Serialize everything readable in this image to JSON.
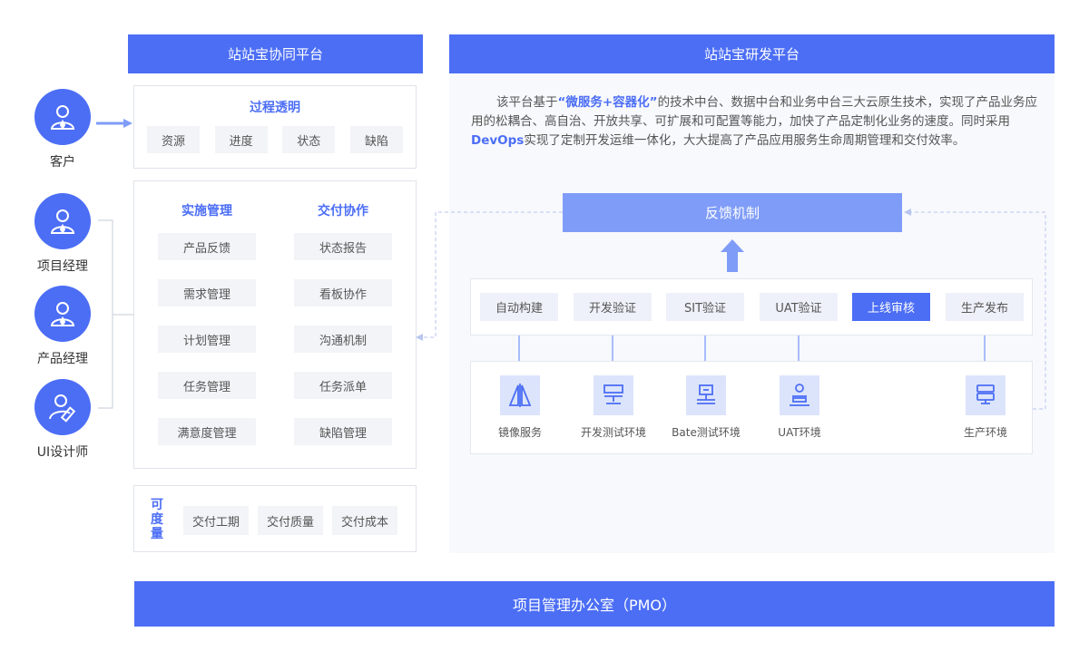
{
  "collab": {
    "title": "站站宝协同平台",
    "process": {
      "title": "过程透明",
      "items": [
        "资源",
        "进度",
        "状态",
        "缺陷"
      ]
    },
    "impl": {
      "title": "实施管理",
      "items": [
        "产品反馈",
        "需求管理",
        "计划管理",
        "任务管理",
        "满意度管理"
      ]
    },
    "deliv": {
      "title": "交付协作",
      "items": [
        "状态报告",
        "看板协作",
        "沟通机制",
        "任务派单",
        "缺陷管理"
      ]
    },
    "measure": {
      "title": "可度量",
      "items": [
        "交付工期",
        "交付质量",
        "交付成本"
      ]
    }
  },
  "roles": [
    {
      "label": "客户",
      "icon": "user-tie-icon"
    },
    {
      "label": "项目经理",
      "icon": "user-tie-icon"
    },
    {
      "label": "产品经理",
      "icon": "user-tie-icon"
    },
    {
      "label": "UI设计师",
      "icon": "designer-ruler-icon"
    }
  ],
  "rd": {
    "title": "站站宝研发平台",
    "desc_parts": [
      {
        "t": "该平台基于",
        "hl": false
      },
      {
        "t": "“微服务+容器化”",
        "hl": true
      },
      {
        "t": "的技术中台、数据中台和业务中台三大云原生技术，实现了产品业务应用的松耦合、高自治、开放共享、可扩展和可配置等能力，加快了产品定制化业务的速度。同时采用",
        "hl": false
      },
      {
        "t": "DevOps",
        "hl": true
      },
      {
        "t": "实现了定制开发运维一体化，大大提高了产品应用服务生命周期管理和交付效率。",
        "hl": false
      }
    ],
    "feedback": "反馈机制",
    "stages": [
      "自动构建",
      "开发验证",
      "SIT验证",
      "UAT验证",
      "上线审核",
      "生产发布"
    ],
    "active_stage": "上线审核",
    "envs": [
      {
        "label": "镜像服务",
        "icon": "mirror-icon"
      },
      {
        "label": "开发测试环境",
        "icon": "server-rack-icon"
      },
      {
        "label": "Bate测试环境",
        "icon": "network-node-icon"
      },
      {
        "label": "UAT环境",
        "icon": "stack-person-icon"
      },
      {
        "label": "生产环境",
        "icon": "database-server-icon"
      }
    ]
  },
  "pmo": "项目管理办公室（PMO）",
  "colors": {
    "primary": "#4c6ef5",
    "light_primary": "#7f9cf8",
    "chip_bg": "#f2f4f7",
    "env_bg": "#dce4fb"
  }
}
